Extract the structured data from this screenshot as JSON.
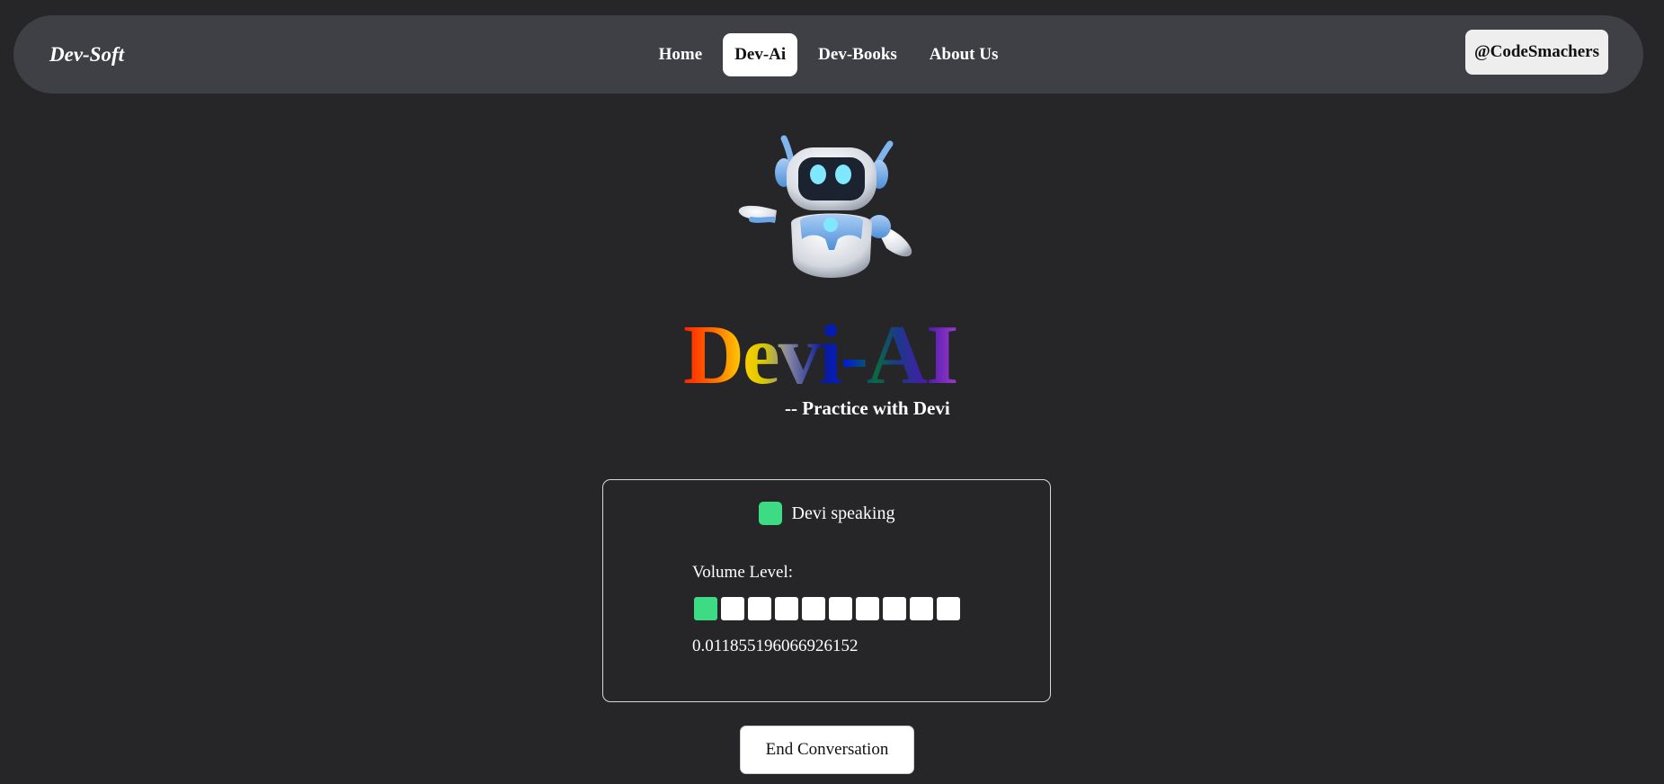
{
  "navbar": {
    "brand": "Dev-Soft",
    "links": [
      {
        "label": "Home",
        "active": false
      },
      {
        "label": "Dev-Ai",
        "active": true
      },
      {
        "label": "Dev-Books",
        "active": false
      },
      {
        "label": "About Us",
        "active": false
      }
    ],
    "profile_label": "@CodeSmachers"
  },
  "hero": {
    "title": "Devi-AI",
    "subtitle": "-- Practice with Devi",
    "image_icon": "robot-mascot-icon"
  },
  "status_card": {
    "status_text": "Devi speaking",
    "status_color": "#3ddc84",
    "volume_label": "Volume Level:",
    "volume_bars_total": 10,
    "volume_bars_active": 1,
    "volume_value": "0.011855196066926152"
  },
  "end_button_label": "End Conversation",
  "colors": {
    "background": "#262628",
    "navbar": "#3f4045",
    "accent_green": "#3ddc84"
  }
}
